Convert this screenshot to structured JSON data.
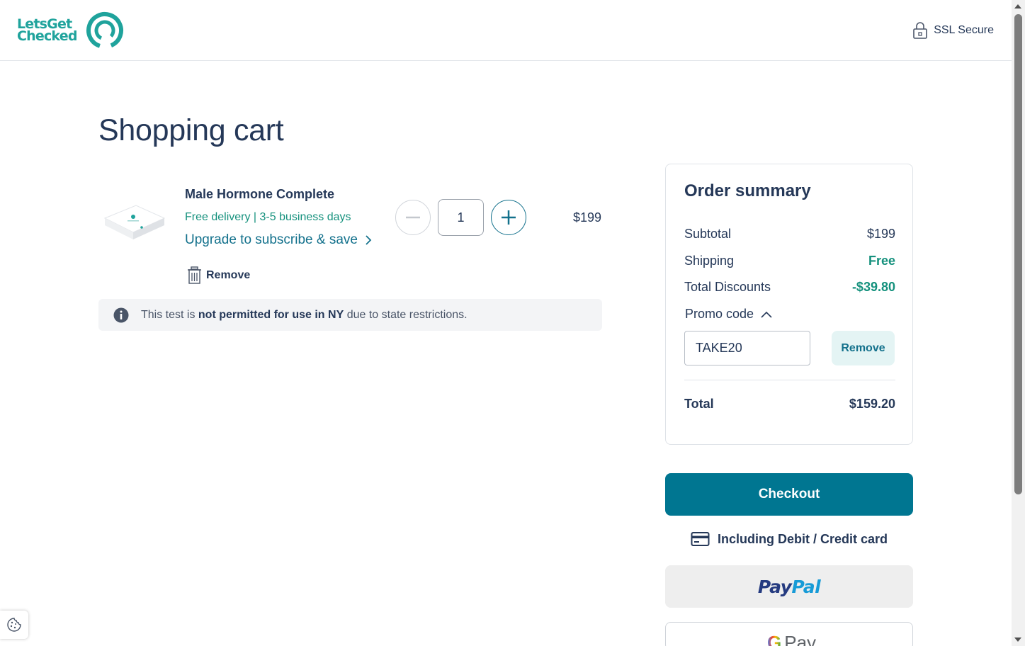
{
  "header": {
    "logo_line1": "LetsGet",
    "logo_line2": "Checked",
    "ssl_label": "SSL Secure",
    "brand_color": "#1fa39c"
  },
  "page_title": "Shopping cart",
  "cart": {
    "item": {
      "name": "Male Hormone Complete",
      "delivery": "Free delivery | 3-5 business days",
      "upgrade_label": "Upgrade to subscribe & save",
      "remove_label": "Remove",
      "quantity": "1",
      "price": "$199"
    },
    "notice": {
      "prefix": "This test is ",
      "bold": "not permitted for use in NY",
      "suffix": " due to state restrictions."
    }
  },
  "summary": {
    "title": "Order summary",
    "subtotal_label": "Subtotal",
    "subtotal_value": "$199",
    "shipping_label": "Shipping",
    "shipping_value": "Free",
    "discounts_label": "Total Discounts",
    "discounts_value": "-$39.80",
    "promo_label": "Promo code",
    "promo_value": "TAKE20",
    "promo_remove_label": "Remove",
    "total_label": "Total",
    "total_value": "$159.20"
  },
  "payment": {
    "checkout_label": "Checkout",
    "card_note": "Including Debit / Credit card",
    "paypal_part1": "Pay",
    "paypal_part2": "Pal",
    "gpay_label": "Pay",
    "accent_color": "#007691"
  }
}
